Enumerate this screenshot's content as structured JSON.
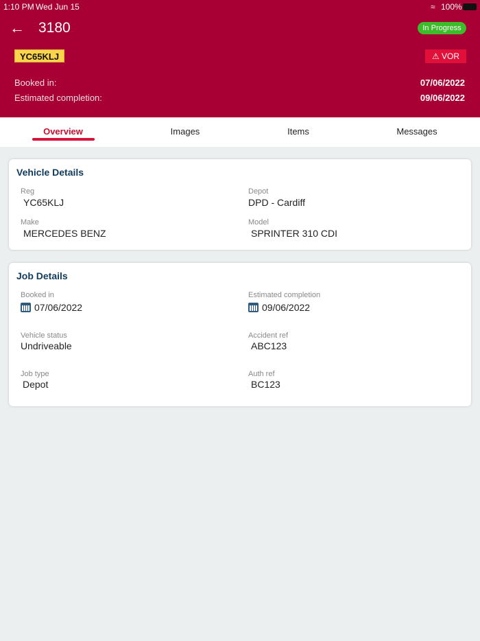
{
  "status_bar": {
    "time": "1:10 PM",
    "date": "Wed Jun 15",
    "battery": "100%"
  },
  "header": {
    "title": "3180",
    "status": "In Progress",
    "reg_plate": "YC65KLJ",
    "vor_label": "VOR",
    "booked_in_label": "Booked in:",
    "booked_in": "07/06/2022",
    "est_label": "Estimated completion:",
    "est": "09/06/2022"
  },
  "tabs": [
    "Overview",
    "Images",
    "Items",
    "Messages"
  ],
  "vehicle": {
    "title": "Vehicle Details",
    "fields": [
      {
        "label": "Reg",
        "value": "YC65KLJ"
      },
      {
        "label": "Depot",
        "value": "DPD - Cardiff"
      },
      {
        "label": "Make",
        "value": "MERCEDES BENZ"
      },
      {
        "label": "Model",
        "value": "SPRINTER 310 CDI"
      }
    ]
  },
  "job": {
    "title": "Job Details",
    "fields": [
      {
        "label": "Booked in",
        "value": "07/06/2022"
      },
      {
        "label": "Estimated completion",
        "value": "09/06/2022"
      },
      {
        "label": "Vehicle status",
        "value": "Undriveable"
      },
      {
        "label": "Accident ref",
        "value": "ABC123"
      },
      {
        "label": "Job type",
        "value": "Depot"
      },
      {
        "label": "Auth ref",
        "value": "BC123"
      }
    ]
  }
}
